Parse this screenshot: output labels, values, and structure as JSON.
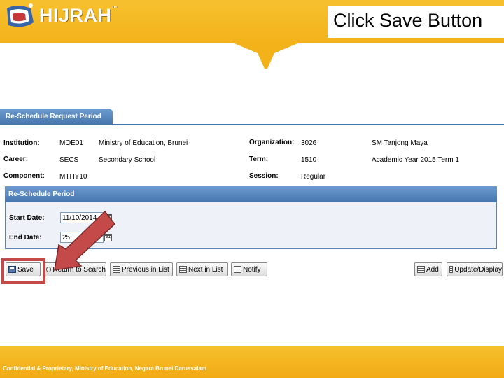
{
  "slide_title": "Click Save Button",
  "logo": {
    "text": "HIJRAH",
    "tm": "™",
    "tagline": ""
  },
  "tab": {
    "label": "Re-Schedule Request Period"
  },
  "info": {
    "institution_label": "Institution:",
    "institution_code": "MOE01",
    "institution_name": "Ministry of Education, Brunei",
    "career_label": "Career:",
    "career_code": "SECS",
    "career_name": "Secondary School",
    "component_label": "Component:",
    "component_code": "MTHY10",
    "organization_label": "Organization:",
    "organization_code": "3026",
    "organization_name": "SM Tanjong Maya",
    "term_label": "Term:",
    "term_code": "1510",
    "term_name": "Academic Year 2015 Term 1",
    "session_label": "Session:",
    "session_value": "Regular"
  },
  "group": {
    "title": "Re-Schedule Period",
    "start_label": "Start Date:",
    "start_value": "11/10/2014",
    "end_label": "End Date:",
    "end_value": "25"
  },
  "toolbar": {
    "save": "Save",
    "return_to_search": "Return to Search",
    "previous_in_list": "Previous in List",
    "next_in_list": "Next in List",
    "notify": "Notify",
    "add": "Add",
    "update_display": "Update/Display"
  },
  "footer": {
    "text": "Confidential & Proprietary, Ministry of Education, Negara Brunei Darussalam"
  },
  "colors": {
    "banner": "#f3b21a",
    "tab": "#4575ad",
    "group_bg": "#eef2f8",
    "highlight": "#c44a4a"
  }
}
